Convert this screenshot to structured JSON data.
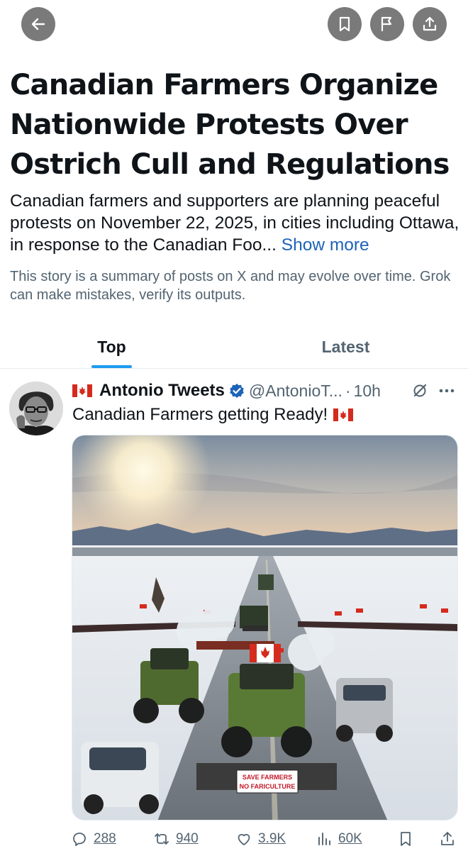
{
  "topbar": {
    "back": {
      "icon": "arrow-left-icon"
    },
    "bookmark": {
      "icon": "bookmark-icon"
    },
    "report": {
      "icon": "flag-icon"
    },
    "share": {
      "icon": "share-icon"
    }
  },
  "story": {
    "title": "Canadian Farmers Organize Nationwide Protests Over Ostrich Cull and Regulations",
    "summary": "Canadian farmers and supporters are planning peaceful protests on November 22, 2025, in cities including Ottawa, in response to the Canadian Foo...",
    "show_more": "Show more",
    "disclaimer": "This story is a summary of posts on X and may evolve over time. Grok can make mistakes, verify its outputs."
  },
  "tabs": [
    {
      "label": "Top",
      "active": true
    },
    {
      "label": "Latest",
      "active": false
    }
  ],
  "post": {
    "author": "Antonio Tweets",
    "handle": "@AntonioT...",
    "separator": "·",
    "time": "10h",
    "text": "Canadian Farmers getting Ready!",
    "media_sign": {
      "line1": "SAVE FARMERS",
      "line2": "NO FARICULTURE"
    },
    "stats": {
      "replies": "288",
      "reposts": "940",
      "likes": "3.9K",
      "views": "60K"
    }
  },
  "colors": {
    "accent": "#1d9bf0",
    "link": "#1d63b8",
    "muted": "#536471",
    "button_bg": "#7a7a7a",
    "flag_red": "#d52b1e"
  }
}
